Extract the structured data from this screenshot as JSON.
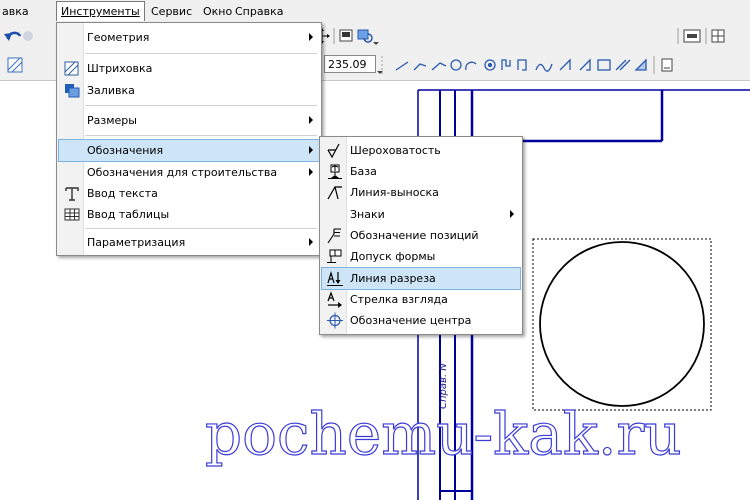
{
  "menubar": {
    "items": [
      {
        "label": "авка"
      },
      {
        "label": "Инструменты"
      },
      {
        "label": "Сервис"
      },
      {
        "label": "Окно"
      },
      {
        "label": "Справка"
      }
    ]
  },
  "toolbar": {
    "scale_value": "235.09",
    "buttons": [
      "undo-icon",
      "move-icon",
      "image-icon",
      "refresh-icon",
      "layout-icon"
    ]
  },
  "tools_menu": {
    "items": [
      {
        "label": "Геометрия",
        "submenu": true
      },
      {
        "label": "Штриховка",
        "icon": "hatch-icon"
      },
      {
        "label": "Заливка",
        "icon": "fill-icon"
      },
      {
        "label": "Размеры",
        "submenu": true
      },
      {
        "label": "Обозначения",
        "submenu": true,
        "highlighted": true
      },
      {
        "label": "Обозначения для строительства",
        "submenu": true
      },
      {
        "label": "Ввод текста",
        "icon": "text-icon"
      },
      {
        "label": "Ввод таблицы",
        "icon": "table-icon"
      },
      {
        "label": "Параметризация",
        "submenu": true
      }
    ]
  },
  "designations_menu": {
    "items": [
      {
        "label": "Шероховатость",
        "icon": "roughness-icon"
      },
      {
        "label": "База",
        "icon": "base-icon"
      },
      {
        "label": "Линия-выноска",
        "icon": "leader-line-icon"
      },
      {
        "label": "Знаки",
        "submenu": true
      },
      {
        "label": "Обозначение позиций",
        "icon": "position-icon"
      },
      {
        "label": "Допуск формы",
        "icon": "tolerance-icon"
      },
      {
        "label": "Линия разреза",
        "icon": "section-line-icon",
        "highlighted": true
      },
      {
        "label": "Стрелка взгляда",
        "icon": "view-arrow-icon"
      },
      {
        "label": "Обозначение центра",
        "icon": "center-mark-icon"
      }
    ]
  },
  "drawing": {
    "vertical_label": "Справ. N",
    "line_color": "#0000a0"
  },
  "watermark": "pochemu-kak.ru",
  "colors": {
    "menu_highlight": "#cde5f7",
    "drawing_blue": "#0000a0"
  }
}
